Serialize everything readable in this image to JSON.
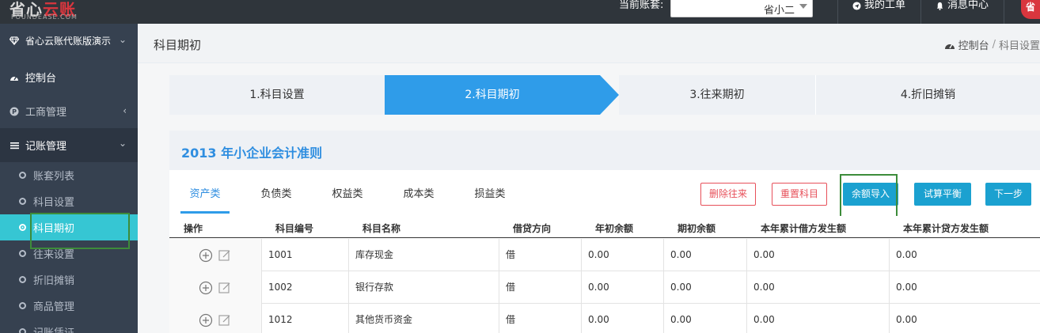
{
  "topbar": {
    "logo_main_gray": "省心",
    "logo_main_red": "云账",
    "logo_sub": "FOUNDEASE.COM",
    "account_label": "当前账套:",
    "account_value": "省小二",
    "my_tickets": "我的工单",
    "message_center": "消息中心",
    "corner_logo": "省"
  },
  "sidebar": {
    "org_name": "省心云账代账版演示",
    "items": [
      {
        "label": "控制台"
      },
      {
        "label": "工商管理"
      },
      {
        "label": "记账管理"
      }
    ],
    "sub_items": [
      {
        "label": "账套列表"
      },
      {
        "label": "科目设置"
      },
      {
        "label": "科目期初"
      },
      {
        "label": "往来设置"
      },
      {
        "label": "折旧摊销"
      },
      {
        "label": "商品管理"
      },
      {
        "label": "记账凭证"
      }
    ]
  },
  "page": {
    "title": "科目期初",
    "breadcrumb_home": "控制台",
    "breadcrumb_sep": "/",
    "breadcrumb_current": "科目设置"
  },
  "steps": [
    {
      "label": "1.科目设置"
    },
    {
      "label": "2.科目期初"
    },
    {
      "label": "3.往来期初"
    },
    {
      "label": "4.折旧摊销"
    }
  ],
  "ruleset_title": "2013 年小企业会计准则",
  "tabs": [
    {
      "label": "资产类"
    },
    {
      "label": "负债类"
    },
    {
      "label": "权益类"
    },
    {
      "label": "成本类"
    },
    {
      "label": "损益类"
    }
  ],
  "buttons": {
    "delete_contacts": "删除往来",
    "reset_subjects": "重置科目",
    "import_balance": "余额导入",
    "trial_balance": "试算平衡",
    "next_step": "下一步"
  },
  "table": {
    "headers": [
      "操作",
      "科目编号",
      "科目名称",
      "借贷方向",
      "年初余额",
      "期初余额",
      "本年累计借方发生额",
      "本年累计贷方发生额"
    ],
    "rows": [
      {
        "code": "1001",
        "name": "库存现金",
        "dir": "借",
        "year_start": "0.00",
        "period_start": "0.00",
        "debit": "0.00",
        "credit": "0.00"
      },
      {
        "code": "1002",
        "name": "银行存款",
        "dir": "借",
        "year_start": "0.00",
        "period_start": "0.00",
        "debit": "0.00",
        "credit": "0.00"
      },
      {
        "code": "1012",
        "name": "其他货币资金",
        "dir": "借",
        "year_start": "0.00",
        "period_start": "0.00",
        "debit": "0.00",
        "credit": "0.00"
      }
    ]
  },
  "colors": {
    "topbar": "#2f353b",
    "sidebar": "#364150",
    "active_sub": "#36c6d3",
    "step_active": "#2f9ce9",
    "accent_blue": "#2f8ee0",
    "danger": "#e7505a",
    "highlight_box": "#3d8c3a"
  }
}
